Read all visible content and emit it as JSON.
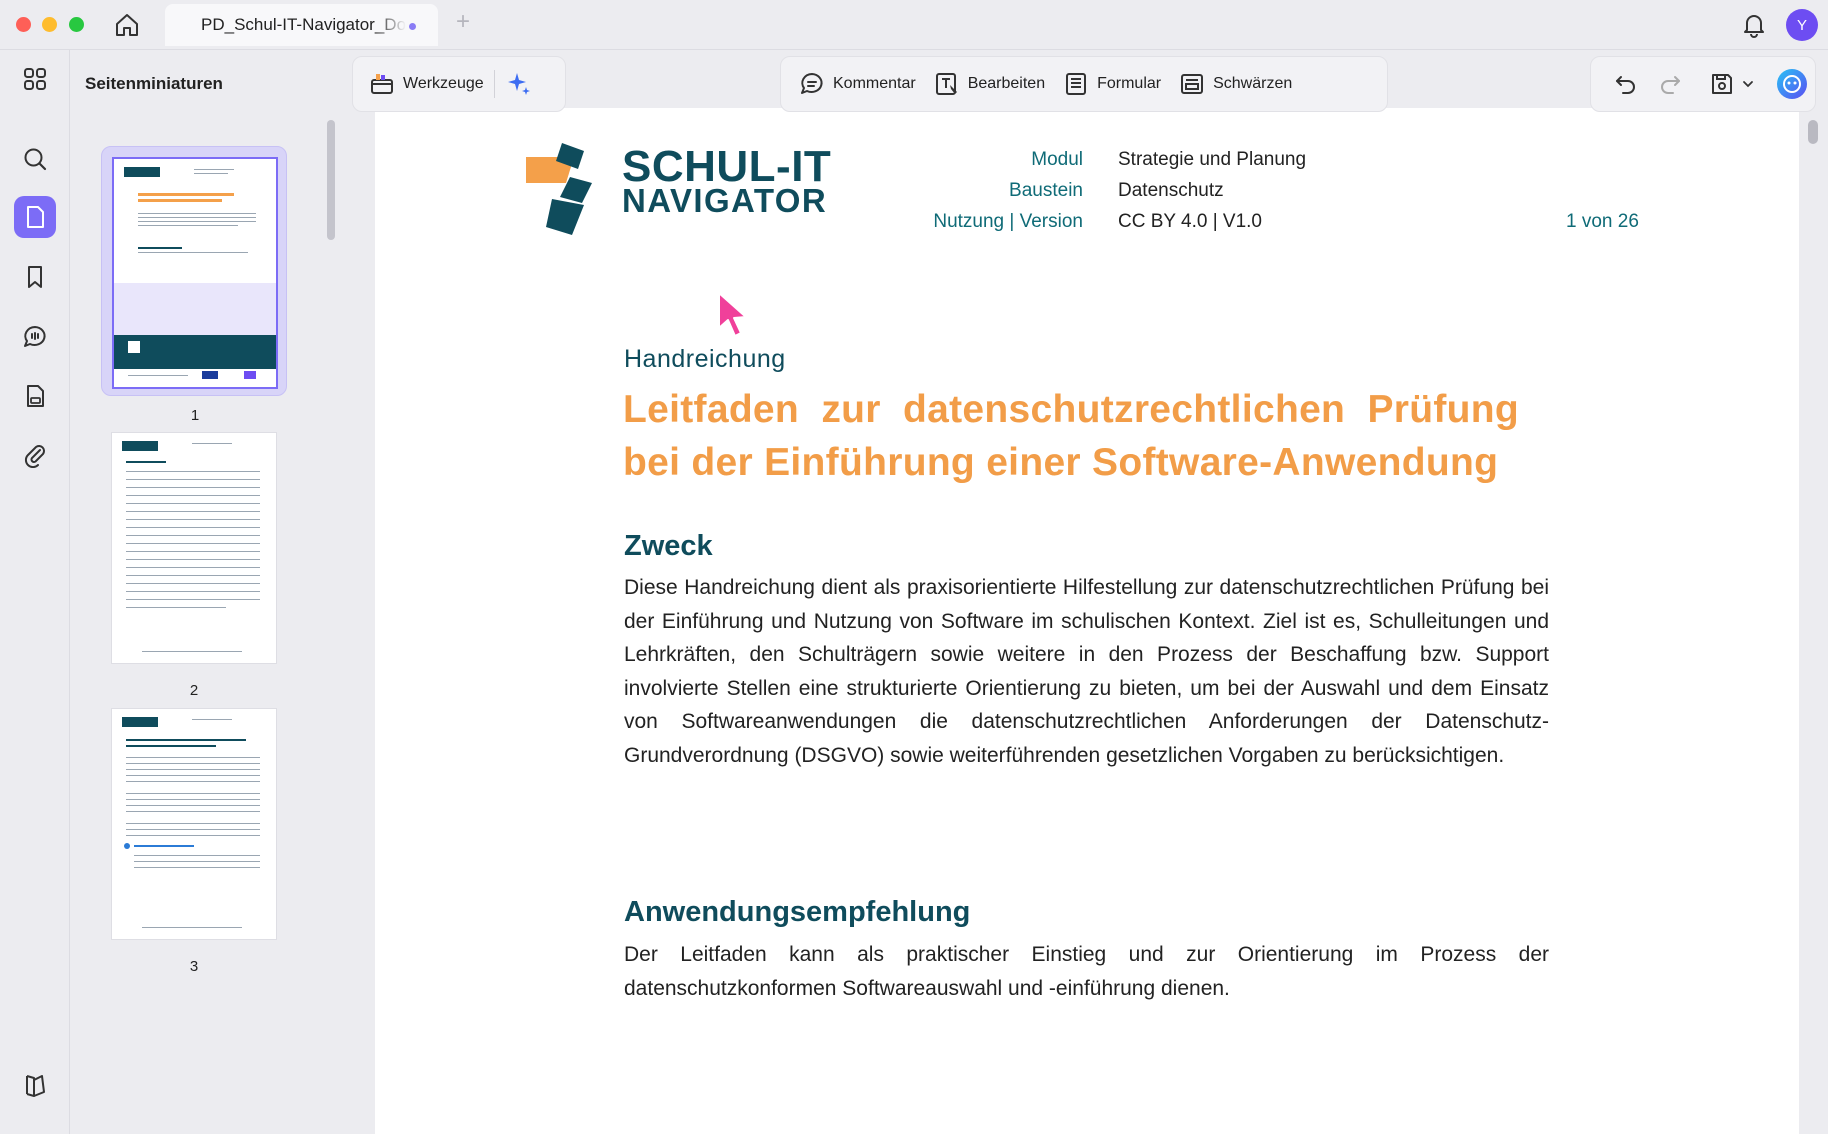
{
  "window": {
    "tab_title": "PD_Schul-IT-Navigator_Do",
    "new_tab_glyph": "+",
    "avatar_initial": "Y"
  },
  "rail": {
    "icons": [
      "grid-icon",
      "search-icon",
      "page-icon",
      "bookmark-icon",
      "comment-icon",
      "attachment-page-icon",
      "paperclip-icon",
      "sidebar-toggle-icon"
    ],
    "accent": "#7c6cf6"
  },
  "thumbnails": {
    "title": "Seitenminiaturen",
    "pages": [
      {
        "number": "1"
      },
      {
        "number": "2"
      },
      {
        "number": "3"
      }
    ]
  },
  "toolbar": {
    "tools_label": "Werkzeuge",
    "comment_label": "Kommentar",
    "edit_label": "Bearbeiten",
    "form_label": "Formular",
    "redact_label": "Schwärzen"
  },
  "document": {
    "logo_line1": "SCHUL-IT",
    "logo_line2": "NAVIGATOR",
    "meta": {
      "modul_label": "Modul",
      "modul_value": "Strategie und Planung",
      "baustein_label": "Baustein",
      "baustein_value": "Datenschutz",
      "nutzung_label": "Nutzung | Version",
      "nutzung_value": "CC BY 4.0 | V1.0"
    },
    "page_of": "1 von 26",
    "eyebrow": "Handreichung",
    "headline_line1": "Leitfaden  zur  datenschutzrechtlichen  Prüfung",
    "headline_line2": "bei der Einführung einer Software-Anwendung",
    "section1_title": "Zweck",
    "section1_text": "Diese Handreichung dient als praxisorientierte Hilfestellung zur datenschutzrechtlichen Prüfung bei der Einführung und Nutzung von Software im schulischen Kontext. Ziel ist es, Schulleitungen und Lehrkräften, den Schulträgern sowie weitere in den Prozess der Beschaffung bzw. Support involvierte Stellen eine strukturierte Orientierung zu bieten, um bei der Auswahl und dem Einsatz von Softwareanwendungen die datenschutzrechtlichen Anforderungen der Datenschutz-Grundverordnung (DSGVO) sowie weiterführenden gesetzlichen Vorgaben zu berücksichtigen.",
    "section2_title": "Anwendungsempfehlung",
    "section2_text": "Der Leitfaden kann als praktischer Einstieg und zur Orientierung im Prozess der datenschutzkonformen Softwareauswahl und -einführung dienen."
  },
  "colors": {
    "brand_teal": "#0f4c5c",
    "brand_orange": "#f29d48",
    "meta_teal": "#0f6b77"
  }
}
